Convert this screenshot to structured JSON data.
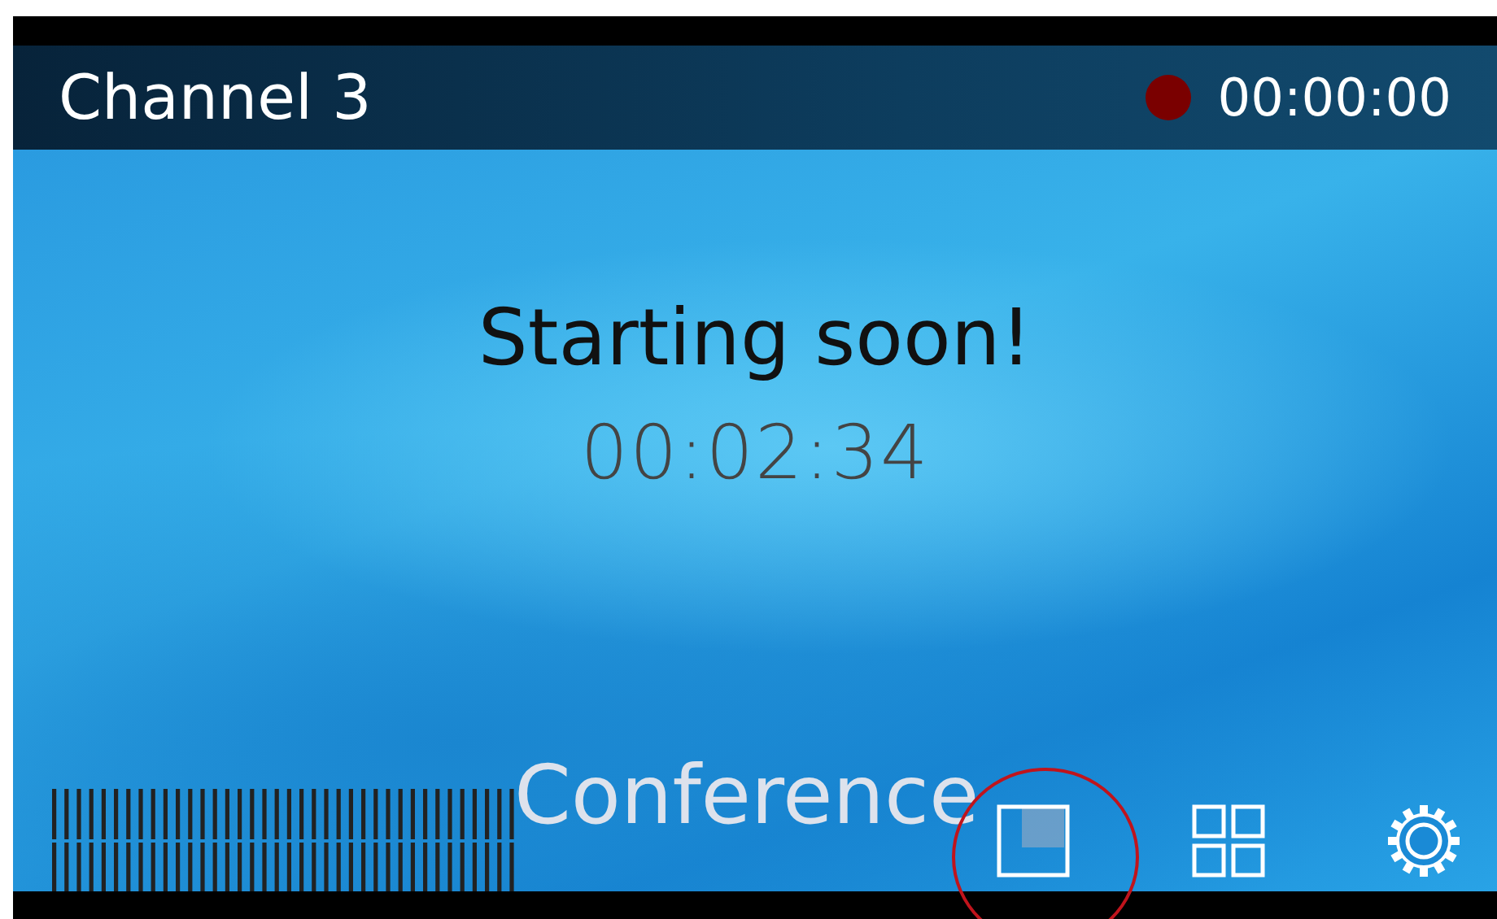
{
  "header": {
    "title": "Channel 3",
    "recording": true,
    "timer": "00:00:00"
  },
  "main": {
    "heading": "Starting soon!",
    "countdown": "00:02:34"
  },
  "footer": {
    "label": "Conference",
    "buttons": [
      {
        "kind": "single",
        "selected": true
      },
      {
        "kind": "quad",
        "selected": false
      },
      {
        "kind": "settings",
        "selected": false
      }
    ]
  }
}
